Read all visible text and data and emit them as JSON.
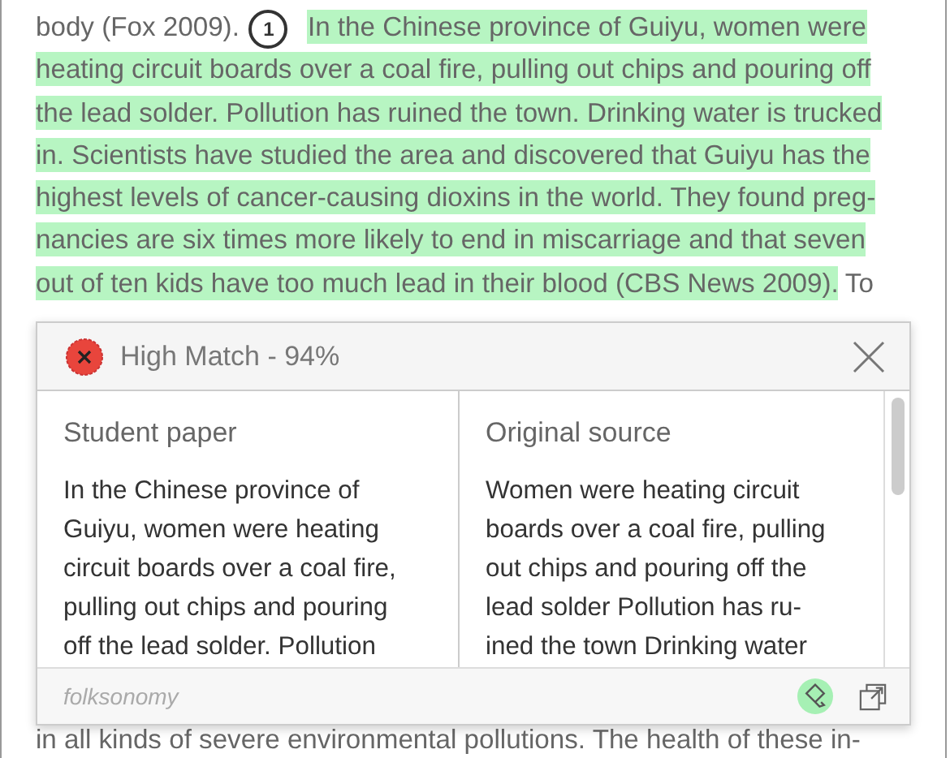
{
  "document": {
    "lines": [
      [
        {
          "text": "body (Fox 2009).",
          "highlighted": false
        },
        {
          "kind": "marker",
          "text": "1"
        },
        {
          "text": "In the Chinese province of Guiyu, women were",
          "highlighted": true
        }
      ],
      [
        {
          "text": "heating circuit boards over a coal fire, pulling out chips and pouring off",
          "highlighted": true
        }
      ],
      [
        {
          "text": "the lead solder. Pollution has ruined the town. Drinking water is trucked",
          "highlighted": true
        }
      ],
      [
        {
          "text": "in. Scientists have studied the area and discovered that Guiyu has the",
          "highlighted": true
        }
      ],
      [
        {
          "text": "highest levels of cancer-causing dioxins in the world. They found preg-",
          "highlighted": true
        }
      ],
      [
        {
          "text": "nancies are six times more likely to end in miscarriage and that seven",
          "highlighted": true
        }
      ],
      [
        {
          "text": "out of ten kids have too much lead in their blood (CBS News 2009).",
          "highlighted": true
        },
        {
          "text": "To",
          "highlighted": false
        }
      ],
      [
        {
          "text": "in all kinds of severe environmental pollutions. The health of these in-",
          "highlighted": false
        }
      ]
    ]
  },
  "popup": {
    "title": "High Match - 94%",
    "columns": [
      {
        "heading": "Student paper",
        "lines": [
          "In the Chinese province of",
          "Guiyu, women were heating",
          "circuit boards over a coal fire,",
          "pulling out chips and pouring",
          "off the lead solder. Pollution"
        ]
      },
      {
        "heading": "Original source",
        "lines": [
          "Women were heating circuit",
          "boards over a coal fire, pulling",
          "out chips and pouring off the",
          "lead solder Pollution has ru-",
          "ined the town Drinking water"
        ]
      }
    ],
    "footer_tag": "folksonomy",
    "highlight_on": true
  }
}
